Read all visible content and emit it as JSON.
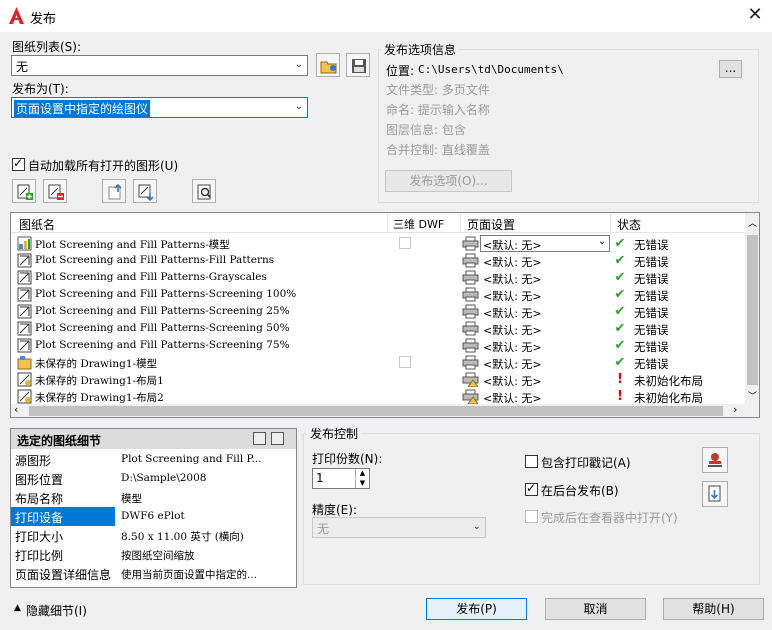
{
  "window": {
    "title": "发布"
  },
  "sheet_list": {
    "label": "图纸列表(S):",
    "value": "无"
  },
  "publish_to": {
    "label": "发布为(T):",
    "value": "页面设置中指定的绘图仪"
  },
  "options_info": {
    "title": "发布选项信息",
    "location_label": "位置:",
    "location_value": "C:\\Users\\td\\Documents\\",
    "browse_label": "...",
    "file_type": "文件类型: 多页文件",
    "naming": "命名: 提示输入名称",
    "layer_info": "图层信息: 包含",
    "merge_control": "合并控制: 直线覆盖",
    "options_button": "发布选项(O)..."
  },
  "auto_load": {
    "label": "自动加载所有打开的图形(U)",
    "checked": true
  },
  "table": {
    "columns": [
      "图纸名",
      "三维 DWF",
      "页面设置",
      "状态"
    ],
    "rows": [
      {
        "name": "Plot Screening and Fill Patterns-模型",
        "type": "model",
        "page_setup": "<默认: 无>",
        "status": "无错误",
        "status_type": "ok",
        "cb": true,
        "active": true
      },
      {
        "name": "Plot Screening and Fill Patterns-Fill Patterns",
        "type": "layout",
        "page_setup": "<默认: 无>",
        "status": "无错误",
        "status_type": "ok",
        "cb": false
      },
      {
        "name": "Plot Screening and Fill Patterns-Grayscales",
        "type": "layout",
        "page_setup": "<默认: 无>",
        "status": "无错误",
        "status_type": "ok",
        "cb": false
      },
      {
        "name": "Plot Screening and Fill Patterns-Screening 100%",
        "type": "layout",
        "page_setup": "<默认: 无>",
        "status": "无错误",
        "status_type": "ok",
        "cb": false
      },
      {
        "name": "Plot Screening and Fill Patterns-Screening 25%",
        "type": "layout",
        "page_setup": "<默认: 无>",
        "status": "无错误",
        "status_type": "ok",
        "cb": false
      },
      {
        "name": "Plot Screening and Fill Patterns-Screening 50%",
        "type": "layout",
        "page_setup": "<默认: 无>",
        "status": "无错误",
        "status_type": "ok",
        "cb": false
      },
      {
        "name": "Plot Screening and Fill Patterns-Screening 75%",
        "type": "layout",
        "page_setup": "<默认: 无>",
        "status": "无错误",
        "status_type": "ok",
        "cb": false
      },
      {
        "name": "未保存的 Drawing1-模型",
        "type": "model2",
        "page_setup": "<默认: 无>",
        "status": "无错误",
        "status_type": "ok",
        "cb": true
      },
      {
        "name": "未保存的 Drawing1-布局1",
        "type": "layout2",
        "page_setup": "<默认: 无>",
        "status": "未初始化布局",
        "status_type": "err",
        "cb": false
      },
      {
        "name": "未保存的 Drawing1-布局2",
        "type": "layout2",
        "page_setup": "<默认: 无>",
        "status": "未初始化布局",
        "status_type": "err",
        "cb": false
      }
    ]
  },
  "details": {
    "title": "选定的图纸细节",
    "rows": [
      {
        "k": "源图形",
        "v": "Plot Screening and Fill P..."
      },
      {
        "k": "图形位置",
        "v": "D:\\Sample\\2008"
      },
      {
        "k": "布局名称",
        "v": "模型"
      },
      {
        "k": "打印设备",
        "v": "DWF6 ePlot"
      },
      {
        "k": "打印大小",
        "v": "8.50 x 11.00 英寸 (横向)"
      },
      {
        "k": "打印比例",
        "v": "按图纸空间缩放"
      },
      {
        "k": "页面设置详细信息",
        "v": "使用当前页面设置中指定的..."
      }
    ]
  },
  "publish_control": {
    "title": "发布控制",
    "copies_label": "打印份数(N):",
    "copies_value": "1",
    "precision_label": "精度(E):",
    "precision_value": "无",
    "include_stamp": "包含打印戳记(A)",
    "background": "在后台发布(B)",
    "open_viewer": "完成后在查看器中打开(Y)"
  },
  "footer": {
    "hide_details": "隐藏细节(I)",
    "publish": "发布(P)",
    "cancel": "取消",
    "help": "帮助(H)"
  }
}
